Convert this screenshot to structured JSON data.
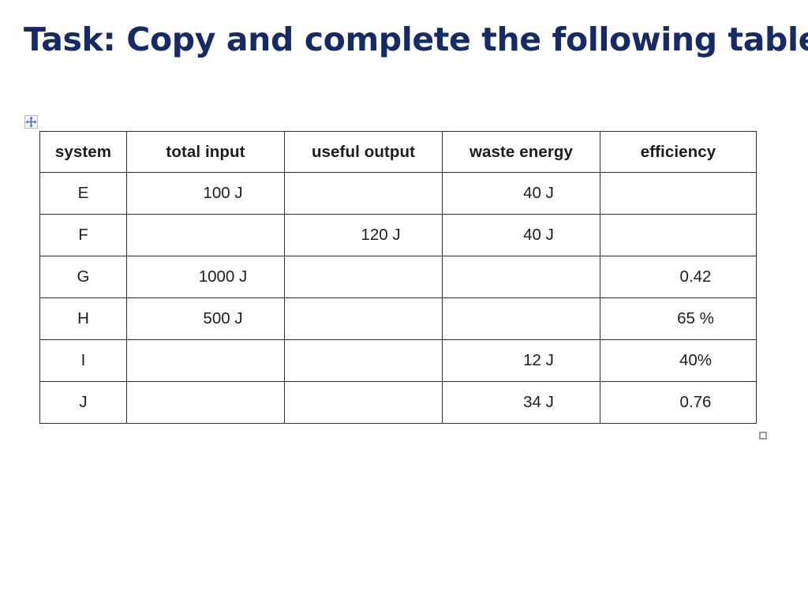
{
  "slide": {
    "title_main": "Task: Copy and complete the following table",
    "title_colon": ":"
  },
  "table": {
    "move_handle_icon": "move-four-arrows-icon",
    "resize_handle_icon": "resize-square-icon",
    "columns": [
      {
        "key": "system",
        "label": "system"
      },
      {
        "key": "total_input",
        "label": "total input"
      },
      {
        "key": "useful_output",
        "label": "useful output"
      },
      {
        "key": "waste_energy",
        "label": "waste energy"
      },
      {
        "key": "efficiency",
        "label": "efficiency"
      }
    ],
    "rows": [
      {
        "system": "E",
        "total_input": "100 J",
        "useful_output": "",
        "waste_energy": "40 J",
        "efficiency": ""
      },
      {
        "system": "F",
        "total_input": "",
        "useful_output": "120 J",
        "waste_energy": "40 J",
        "efficiency": ""
      },
      {
        "system": "G",
        "total_input": "1000 J",
        "useful_output": "",
        "waste_energy": "",
        "efficiency": "0.42"
      },
      {
        "system": "H",
        "total_input": "500 J",
        "useful_output": "",
        "waste_energy": "",
        "efficiency": "65 %"
      },
      {
        "system": "I",
        "total_input": "",
        "useful_output": "",
        "waste_energy": "12 J",
        "efficiency": "40%"
      },
      {
        "system": "J",
        "total_input": "",
        "useful_output": "",
        "waste_energy": "34 J",
        "efficiency": "0.76"
      }
    ]
  },
  "colors": {
    "title": "#152a68",
    "table_border": "#2f2f2f",
    "text": "#1d1d1d",
    "background": "#ffffff"
  }
}
